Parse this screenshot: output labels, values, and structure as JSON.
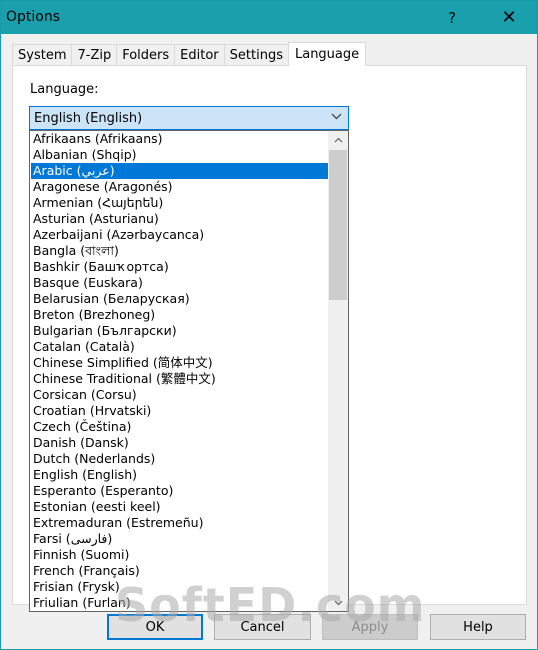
{
  "window": {
    "title": "Options",
    "help_glyph": "?",
    "close_glyph": "✕"
  },
  "tabs": [
    {
      "label": "System"
    },
    {
      "label": "7-Zip"
    },
    {
      "label": "Folders"
    },
    {
      "label": "Editor"
    },
    {
      "label": "Settings"
    },
    {
      "label": "Language",
      "active": true
    }
  ],
  "language": {
    "label": "Language:",
    "selected": "English (English)",
    "highlighted": "Arabic (عربي)",
    "options": [
      "Afrikaans (Afrikaans)",
      "Albanian (Shqip)",
      "Arabic (عربي)",
      "Aragonese (Aragonés)",
      "Armenian (Հայերեն)",
      "Asturian (Asturianu)",
      "Azerbaijani (Azərbaycanca)",
      "Bangla (বাংলা)",
      "Bashkir (Башҡортса)",
      "Basque (Euskara)",
      "Belarusian (Беларуская)",
      "Breton (Brezhoneg)",
      "Bulgarian (Български)",
      "Catalan (Català)",
      "Chinese Simplified (简体中文)",
      "Chinese Traditional (繁體中文)",
      "Corsican (Corsu)",
      "Croatian (Hrvatski)",
      "Czech (Čeština)",
      "Danish (Dansk)",
      "Dutch (Nederlands)",
      "English (English)",
      "Esperanto (Esperanto)",
      "Estonian (eesti keel)",
      "Extremaduran (Estremeñu)",
      "Farsi (فارسی)",
      "Finnish (Suomi)",
      "French (Français)",
      "Frisian (Frysk)",
      "Friulian (Furlan)"
    ]
  },
  "buttons": {
    "ok": "OK",
    "cancel": "Cancel",
    "apply": "Apply",
    "help": "Help"
  },
  "icons": {
    "dropdown_arrow": "chevron-down-icon",
    "scroll_up": "scroll-up-arrow-icon",
    "scroll_down": "scroll-down-arrow-icon"
  },
  "colors": {
    "titlebar": "#1aa0ac",
    "selection": "#0078d7",
    "combo_fill": "#cce4f7"
  },
  "watermark": "SoftED.com"
}
